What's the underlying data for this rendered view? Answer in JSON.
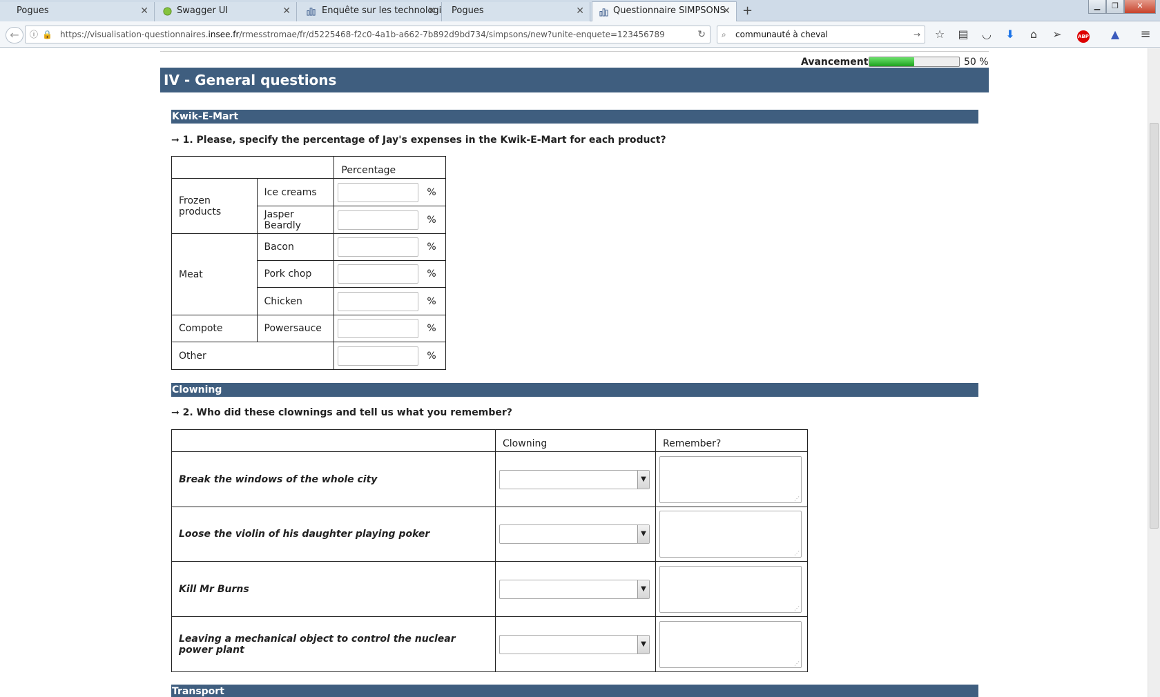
{
  "browser": {
    "tabs": [
      {
        "label": "Pogues"
      },
      {
        "label": "Swagger UI"
      },
      {
        "label": "Enquête sur les technologi..."
      },
      {
        "label": "Pogues"
      },
      {
        "label": "Questionnaire SIMPSONS"
      }
    ],
    "url_prefix": "https://visualisation-questionnaires.",
    "url_domain": "insee.fr",
    "url_rest": "/rmesstromae/fr/d5225468-f2c0-4a1b-a662-7b892d9bd734/simpsons/new?unite-enquete=123456789",
    "search_value": "communauté à cheval",
    "abp_label": "ABP"
  },
  "progress": {
    "label": "Avancement",
    "percent": 50,
    "percent_text": "50 %"
  },
  "section_title": "IV - General questions",
  "kwik": {
    "heading": "Kwik-E-Mart",
    "question": "➞ 1. Please, specify the percentage of Jay's expenses in the Kwik-E-Mart for each product?",
    "col_header": "Percentage",
    "unit": "%",
    "groups": {
      "frozen": "Frozen products",
      "meat": "Meat",
      "compote": "Compote",
      "other": "Other"
    },
    "items": {
      "ice_creams": "Ice creams",
      "jasper": "Jasper Beardly",
      "bacon": "Bacon",
      "pork": "Pork chop",
      "chicken": "Chicken",
      "powersauce": "Powersauce"
    }
  },
  "clowning": {
    "heading": "Clowning",
    "question": "➞ 2. Who did these clownings and tell us what you remember?",
    "col_clowning": "Clowning",
    "col_remember": "Remember?",
    "rows": [
      "Break the windows of the whole city",
      "Loose the violin of his daughter playing poker",
      "Kill Mr Burns",
      "Leaving a mechanical object to control the nuclear power plant"
    ]
  },
  "transport": {
    "heading": "Transport"
  }
}
